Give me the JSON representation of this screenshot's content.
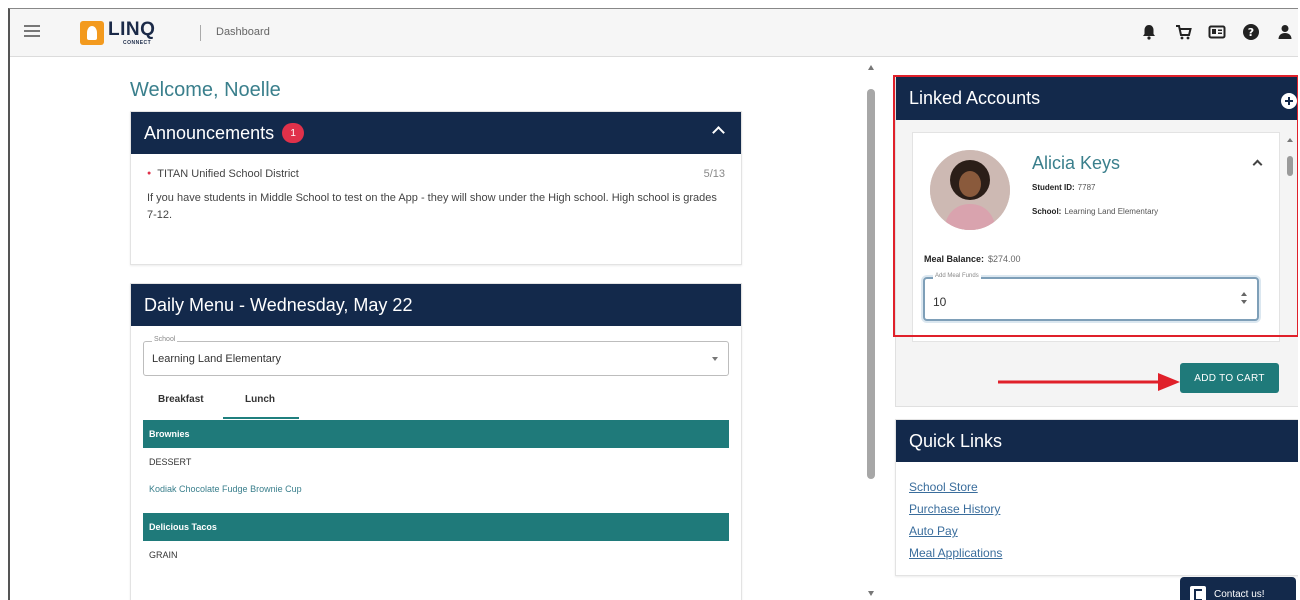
{
  "header": {
    "logo_text": "LINQ",
    "logo_sub": "CONNECT",
    "breadcrumb": "Dashboard",
    "icons": [
      "bell-icon",
      "cart-icon",
      "id-card-icon",
      "help-icon",
      "user-icon"
    ]
  },
  "welcome": "Welcome, Noelle",
  "announcements": {
    "title": "Announcements",
    "count": "1",
    "source": "TITAN Unified School District",
    "date": "5/13",
    "message": "If you have students in Middle School to test on the App - they will show under the High school.  High school is grades 7-12."
  },
  "daily_menu": {
    "title": "Daily Menu - Wednesday, May 22",
    "school_label": "School",
    "school_value": "Learning Land Elementary",
    "tabs": [
      "Breakfast",
      "Lunch"
    ],
    "active_tab": "Lunch",
    "sections": [
      {
        "name": "Brownies",
        "category": "DESSERT",
        "item": "Kodiak Chocolate Fudge Brownie Cup"
      },
      {
        "name": "Delicious Tacos",
        "category": "GRAIN",
        "item": ""
      }
    ]
  },
  "linked_accounts": {
    "title": "Linked Accounts",
    "student": {
      "name": "Alicia Keys",
      "id_label": "Student ID:",
      "id_value": "7787",
      "school_label": "School:",
      "school_value": "Learning Land Elementary",
      "balance_label": "Meal Balance:",
      "balance_value": "$274.00",
      "auto_label": "Add Meal Funds",
      "auto_value": "10"
    },
    "add_button": "ADD TO CART"
  },
  "quick_links": {
    "title": "Quick Links",
    "links": [
      "School Store",
      "Purchase History",
      "Auto Pay",
      "Meal Applications"
    ]
  },
  "contact": "Contact us!",
  "colors": {
    "navy": "#13294b",
    "teal": "#1f7a7a",
    "accent_text": "#3a7f8c",
    "badge_red": "#e0314a",
    "annotation_red": "#e0202a"
  }
}
